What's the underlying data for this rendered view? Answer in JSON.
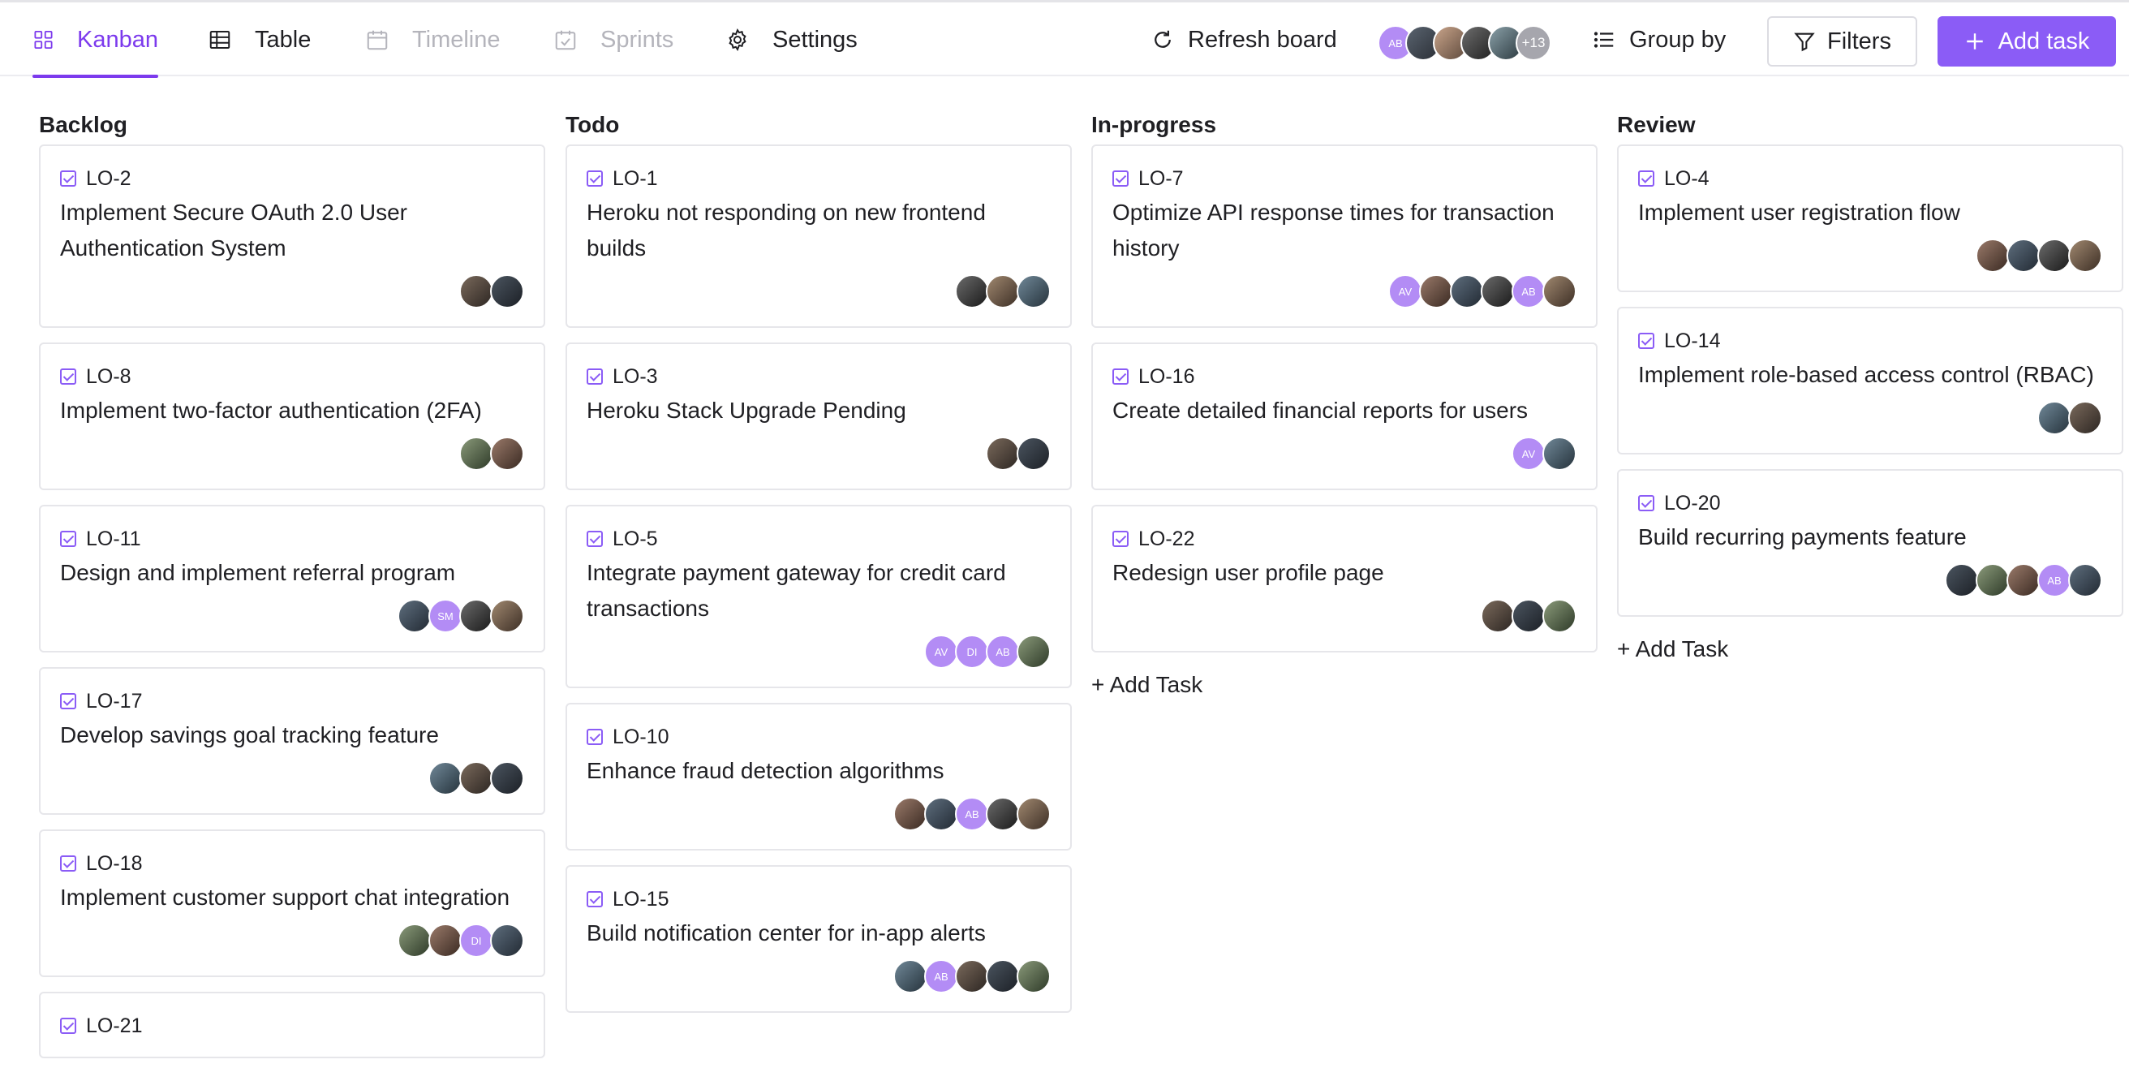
{
  "nav": {
    "tabs": [
      {
        "label": "Kanban",
        "state": "active",
        "icon": "grid-icon"
      },
      {
        "label": "Table",
        "state": "normal",
        "icon": "table-icon"
      },
      {
        "label": "Timeline",
        "state": "disabled",
        "icon": "calendar-icon"
      },
      {
        "label": "Sprints",
        "state": "disabled",
        "icon": "calendar-check-icon"
      },
      {
        "label": "Settings",
        "state": "normal",
        "icon": "gear-icon"
      }
    ],
    "refresh_label": "Refresh board",
    "team_avatars": [
      "AB",
      "photo",
      "photo",
      "photo",
      "photo"
    ],
    "team_more": "+13",
    "group_by_label": "Group by",
    "filters_label": "Filters",
    "add_task_label": "Add task"
  },
  "colors": {
    "accent": "#7c3aed",
    "button": "#8b5cf6",
    "initials_avatar": "#b38cf5"
  },
  "columns": [
    {
      "title": "Backlog",
      "cards": [
        {
          "id": "LO-2",
          "title": "Implement Secure OAuth 2.0 User Authentication System",
          "avatars": [
            "photo",
            "photo"
          ]
        },
        {
          "id": "LO-8",
          "title": "Implement two-factor authentication (2FA)",
          "avatars": [
            "photo",
            "photo"
          ]
        },
        {
          "id": "LO-11",
          "title": "Design and implement referral program",
          "avatars": [
            "photo",
            "SM",
            "photo",
            "photo"
          ]
        },
        {
          "id": "LO-17",
          "title": "Develop savings goal tracking feature",
          "avatars": [
            "photo",
            "photo",
            "photo"
          ]
        },
        {
          "id": "LO-18",
          "title": "Implement customer support chat integration",
          "avatars": [
            "photo",
            "photo",
            "DI",
            "photo"
          ]
        },
        {
          "id": "LO-21",
          "title": "",
          "avatars": []
        }
      ],
      "add_label": ""
    },
    {
      "title": "Todo",
      "cards": [
        {
          "id": "LO-1",
          "title": "Heroku not responding on new frontend builds",
          "avatars": [
            "photo",
            "photo",
            "photo"
          ]
        },
        {
          "id": "LO-3",
          "title": "Heroku Stack Upgrade Pending",
          "avatars": [
            "photo",
            "photo"
          ]
        },
        {
          "id": "LO-5",
          "title": "Integrate payment gateway for credit card transactions",
          "avatars": [
            "AV",
            "DI",
            "AB",
            "photo"
          ]
        },
        {
          "id": "LO-10",
          "title": "Enhance fraud detection algorithms",
          "avatars": [
            "photo",
            "photo",
            "AB",
            "photo",
            "photo"
          ]
        },
        {
          "id": "LO-15",
          "title": "Build notification center for in-app alerts",
          "avatars": [
            "photo",
            "AB",
            "photo",
            "photo",
            "photo"
          ]
        }
      ],
      "add_label": ""
    },
    {
      "title": "In-progress",
      "cards": [
        {
          "id": "LO-7",
          "title": "Optimize API response times for transaction history",
          "avatars": [
            "AV",
            "photo",
            "photo",
            "photo",
            "AB",
            "photo"
          ]
        },
        {
          "id": "LO-16",
          "title": "Create detailed financial reports for users",
          "avatars": [
            "AV",
            "photo"
          ]
        },
        {
          "id": "LO-22",
          "title": "Redesign user profile page",
          "avatars": [
            "photo",
            "photo",
            "photo"
          ]
        }
      ],
      "add_label": "+ Add Task"
    },
    {
      "title": "Review",
      "cards": [
        {
          "id": "LO-4",
          "title": "Implement user registration flow",
          "avatars": [
            "photo",
            "photo",
            "photo",
            "photo"
          ]
        },
        {
          "id": "LO-14",
          "title": "Implement role-based access control (RBAC)",
          "avatars": [
            "photo",
            "photo"
          ]
        },
        {
          "id": "LO-20",
          "title": "Build recurring payments feature",
          "avatars": [
            "photo",
            "photo",
            "photo",
            "AB",
            "photo"
          ]
        }
      ],
      "add_label": "+ Add Task"
    }
  ]
}
